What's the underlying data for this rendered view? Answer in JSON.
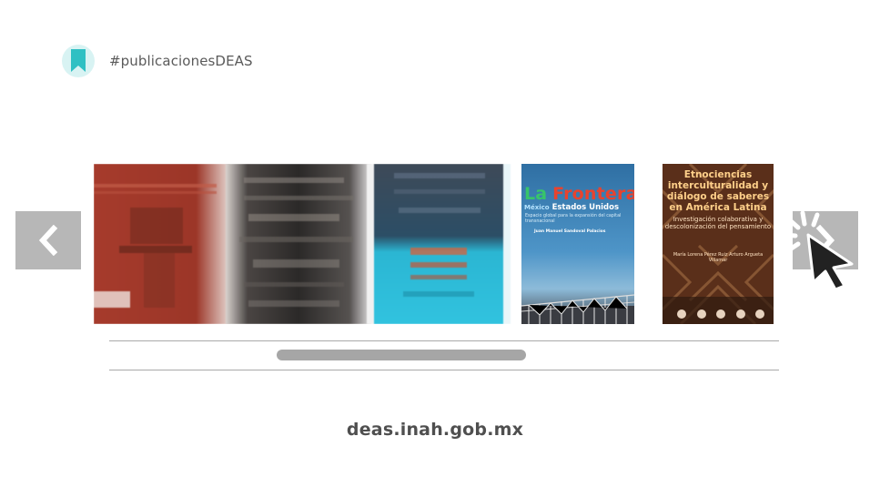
{
  "header": {
    "hashtag": "#publicacionesDEAS",
    "icon": "bookmark-icon",
    "accent_color": "#2fc0c3"
  },
  "carousel": {
    "prev_button_icon": "chevron-left-icon",
    "next_button_icon": "chevron-right-icon",
    "books": [
      {
        "id": "book-1",
        "blurred": true,
        "title": ""
      },
      {
        "id": "book-2",
        "blurred": true,
        "title": ""
      },
      {
        "id": "book-3",
        "blurred": true,
        "title": ""
      },
      {
        "id": "book-4",
        "blurred": false,
        "title_la": "La",
        "title_main": "Frontera",
        "subtitle_mexico": "México",
        "subtitle": "Estados Unidos",
        "tagline": "Espacio global para la expansión del capital transnacional",
        "author": "Juan Manuel Sandoval Palacios"
      },
      {
        "id": "book-5",
        "blurred": false,
        "title": "Etnociencias interculturalidad y diálogo de saberes en América Latina",
        "subtitle": "Investigación colaborativa y descolonización del pensamiento",
        "authors": "María Lorena Pérez Ruiz Arturo Argueta Villamar"
      }
    ]
  },
  "scrollbar": {
    "position_fraction": 0.25,
    "visible_fraction": 0.37
  },
  "footer": {
    "url": "deas.inah.gob.mx"
  }
}
